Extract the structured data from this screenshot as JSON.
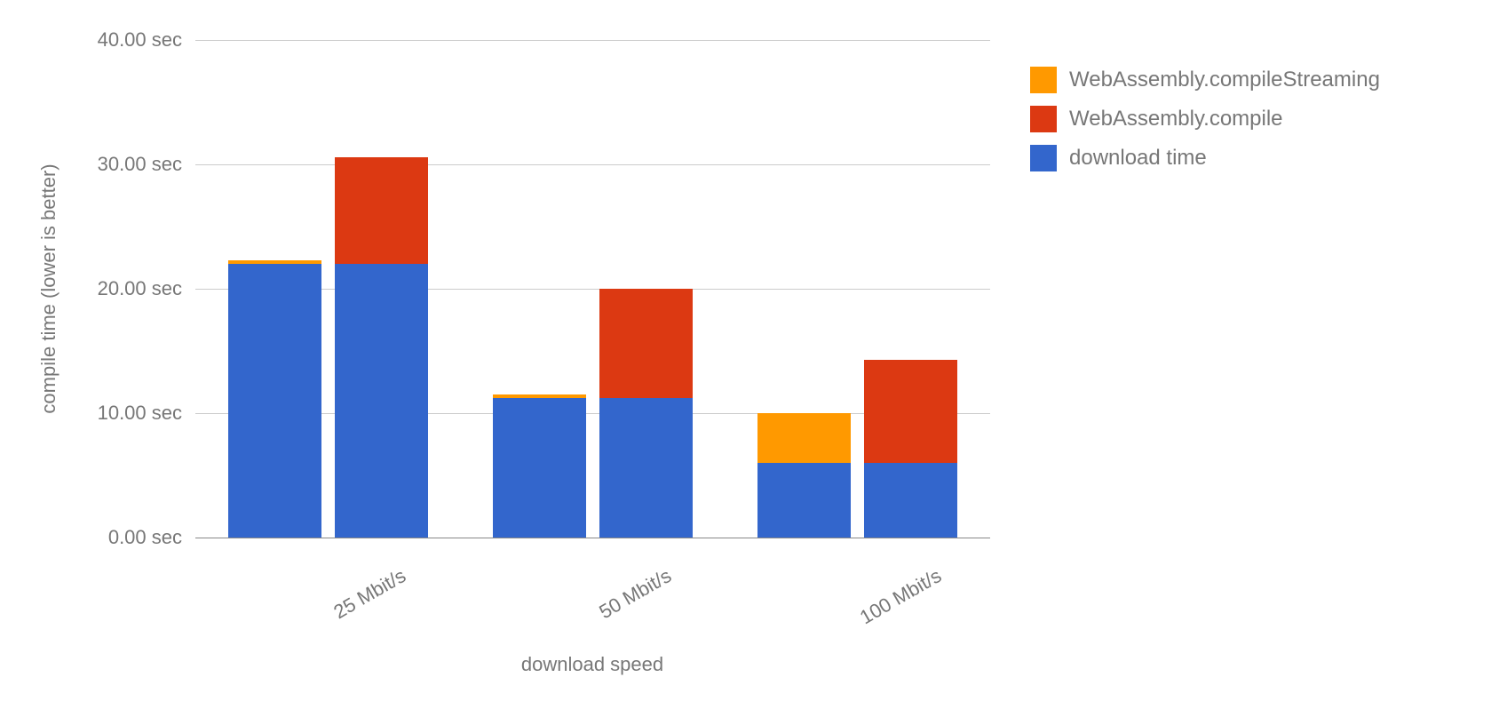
{
  "chart_data": {
    "type": "bar",
    "xlabel": "download speed",
    "ylabel": "compile time (lower is better)",
    "ylim": [
      0,
      40
    ],
    "y_ticks": [
      {
        "value": 0,
        "label": "0.00 sec"
      },
      {
        "value": 10,
        "label": "10.00 sec"
      },
      {
        "value": 20,
        "label": "20.00 sec"
      },
      {
        "value": 30,
        "label": "30.00 sec"
      },
      {
        "value": 40,
        "label": "40.00 sec"
      }
    ],
    "categories": [
      "25 Mbit/s",
      "50 Mbit/s",
      "100 Mbit/s"
    ],
    "legend": [
      {
        "name": "WebAssembly.compileStreaming",
        "color": "#ff9900"
      },
      {
        "name": "WebAssembly.compile",
        "color": "#dc3912"
      },
      {
        "name": "download time",
        "color": "#3366cc"
      }
    ],
    "groups": [
      {
        "category": "25 Mbit/s",
        "bars": [
          {
            "segments": [
              {
                "series": "download time",
                "value": 22.0,
                "color": "#3366cc"
              },
              {
                "series": "WebAssembly.compileStreaming",
                "value": 0.3,
                "color": "#ff9900"
              }
            ]
          },
          {
            "segments": [
              {
                "series": "download time",
                "value": 22.0,
                "color": "#3366cc"
              },
              {
                "series": "WebAssembly.compile",
                "value": 8.6,
                "color": "#dc3912"
              }
            ]
          }
        ]
      },
      {
        "category": "50 Mbit/s",
        "bars": [
          {
            "segments": [
              {
                "series": "download time",
                "value": 11.2,
                "color": "#3366cc"
              },
              {
                "series": "WebAssembly.compileStreaming",
                "value": 0.3,
                "color": "#ff9900"
              }
            ]
          },
          {
            "segments": [
              {
                "series": "download time",
                "value": 11.2,
                "color": "#3366cc"
              },
              {
                "series": "WebAssembly.compile",
                "value": 8.8,
                "color": "#dc3912"
              }
            ]
          }
        ]
      },
      {
        "category": "100 Mbit/s",
        "bars": [
          {
            "segments": [
              {
                "series": "download time",
                "value": 6.0,
                "color": "#3366cc"
              },
              {
                "series": "WebAssembly.compileStreaming",
                "value": 4.0,
                "color": "#ff9900"
              }
            ]
          },
          {
            "segments": [
              {
                "series": "download time",
                "value": 6.0,
                "color": "#3366cc"
              },
              {
                "series": "WebAssembly.compile",
                "value": 8.3,
                "color": "#dc3912"
              }
            ]
          }
        ]
      }
    ]
  }
}
